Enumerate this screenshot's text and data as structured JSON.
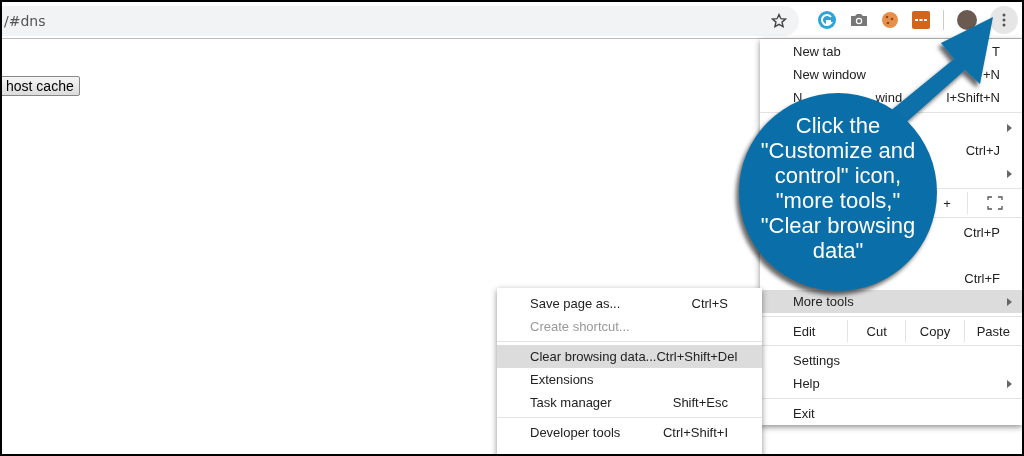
{
  "address_bar": {
    "text": "/#dns"
  },
  "page": {
    "button": "host cache"
  },
  "menu": {
    "items": [
      {
        "kind": "item",
        "label": "New tab",
        "shortcut": "T",
        "submenu": false,
        "highlighted": false
      },
      {
        "kind": "item",
        "label": "New window",
        "shortcut": "+N",
        "submenu": false,
        "highlighted": false
      },
      {
        "kind": "item",
        "label": "N",
        "mid": "wind",
        "shortcut": "l+Shift+N",
        "submenu": false,
        "highlighted": false
      },
      {
        "kind": "divider"
      },
      {
        "kind": "item",
        "submenu": true,
        "highlighted": false
      },
      {
        "kind": "item",
        "shortcut": "Ctrl+J",
        "submenu": false,
        "highlighted": false
      },
      {
        "kind": "item",
        "submenu": true,
        "highlighted": false
      },
      {
        "kind": "divider"
      },
      {
        "kind": "zoom",
        "plus": "+"
      },
      {
        "kind": "divider"
      },
      {
        "kind": "item",
        "shortcut": "Ctrl+P",
        "submenu": false,
        "highlighted": false
      },
      {
        "kind": "item",
        "submenu": false,
        "highlighted": false
      },
      {
        "kind": "item",
        "shortcut": "Ctrl+F",
        "submenu": false,
        "highlighted": false
      },
      {
        "kind": "item",
        "label": "More tools",
        "submenu": true,
        "highlighted": true
      },
      {
        "kind": "divider"
      },
      {
        "kind": "edit",
        "label": "Edit",
        "buttons": [
          "Cut",
          "Copy",
          "Paste"
        ]
      },
      {
        "kind": "divider"
      },
      {
        "kind": "item",
        "label": "Settings",
        "submenu": false,
        "highlighted": false
      },
      {
        "kind": "item",
        "label": "Help",
        "submenu": true,
        "highlighted": false
      },
      {
        "kind": "divider"
      },
      {
        "kind": "item",
        "label": "Exit",
        "submenu": false,
        "highlighted": false
      }
    ]
  },
  "submenu": {
    "items": [
      {
        "kind": "item",
        "label": "Save page as...",
        "shortcut": "Ctrl+S",
        "highlighted": false,
        "disabled": false
      },
      {
        "kind": "item",
        "label": "Create shortcut...",
        "highlighted": false,
        "disabled": true
      },
      {
        "kind": "divider"
      },
      {
        "kind": "item",
        "label": "Clear browsing data...",
        "shortcut": "Ctrl+Shift+Del",
        "highlighted": true,
        "disabled": false
      },
      {
        "kind": "item",
        "label": "Extensions",
        "highlighted": false,
        "disabled": false
      },
      {
        "kind": "item",
        "label": "Task manager",
        "shortcut": "Shift+Esc",
        "highlighted": false,
        "disabled": false
      },
      {
        "kind": "divider"
      },
      {
        "kind": "item",
        "label": "Developer tools",
        "shortcut": "Ctrl+Shift+I",
        "highlighted": false,
        "disabled": false
      }
    ]
  },
  "callout": {
    "text": "Click the \"Customize and control\" icon, \"more tools,\" \"Clear browsing data\""
  }
}
